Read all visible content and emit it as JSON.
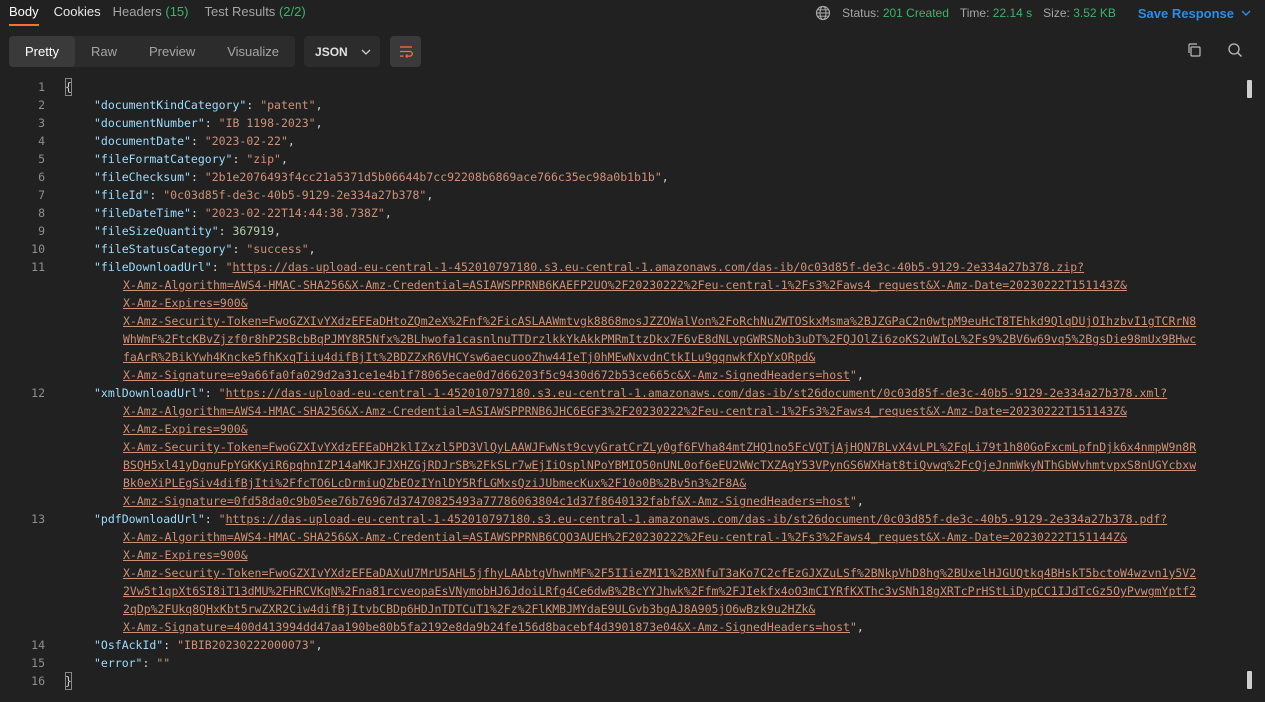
{
  "tabs": {
    "body": "Body",
    "cookies": "Cookies",
    "headers_label": "Headers",
    "headers_count": "(15)",
    "tests_label": "Test Results",
    "tests_count": "(2/2)"
  },
  "status": {
    "status_label": "Status:",
    "status_value": "201 Created",
    "time_label": "Time:",
    "time_value": "22.14 s",
    "size_label": "Size:",
    "size_value": "3.52 KB",
    "save_response": "Save Response"
  },
  "toolbar": {
    "pretty": "Pretty",
    "raw": "Raw",
    "preview": "Preview",
    "visualize": "Visualize",
    "format": "JSON"
  },
  "editor": {
    "line_numbers": [
      "1",
      "2",
      "3",
      "4",
      "5",
      "6",
      "7",
      "8",
      "9",
      "10",
      "11",
      "12",
      "13",
      "14",
      "15",
      "16"
    ],
    "open_brace": "{",
    "close_brace": "}",
    "entries": {
      "documentKindCategory": {
        "key": "\"documentKindCategory\"",
        "value": "\"patent\""
      },
      "documentNumber": {
        "key": "\"documentNumber\"",
        "value": "\"IB 1198-2023\""
      },
      "documentDate": {
        "key": "\"documentDate\"",
        "value": "\"2023-02-22\""
      },
      "fileFormatCategory": {
        "key": "\"fileFormatCategory\"",
        "value": "\"zip\""
      },
      "fileChecksum": {
        "key": "\"fileChecksum\"",
        "value": "\"2b1e2076493f4cc21a5371d5b06644b7cc92208b6869ace766c35ec98a0b1b1b\""
      },
      "fileId": {
        "key": "\"fileId\"",
        "value": "\"0c03d85f-de3c-40b5-9129-2e334a27b378\""
      },
      "fileDateTime": {
        "key": "\"fileDateTime\"",
        "value": "\"2023-02-22T14:44:38.738Z\""
      },
      "fileSizeQuantity": {
        "key": "\"fileSizeQuantity\"",
        "value": "367919"
      },
      "fileStatusCategory": {
        "key": "\"fileStatusCategory\"",
        "value": "\"success\""
      },
      "fileDownloadUrl": {
        "key": "\"fileDownloadUrl\"",
        "q": "\"",
        "lines": [
          "https://das-upload-eu-central-1-452010797180.s3.eu-central-1.amazonaws.com/das-ib/0c03d85f-de3c-40b5-9129-2e334a27b378.zip?",
          "X-Amz-Algorithm=AWS4-HMAC-SHA256&X-Amz-Credential=ASIAWSPPRNB6KAEFP2UO%2F20230222%2Feu-central-1%2Fs3%2Faws4_request&X-Amz-Date=20230222T151143Z&",
          "X-Amz-Expires=900&",
          "X-Amz-Security-Token=FwoGZXIvYXdzEFEaDHtoZQm2eX%2Fnf%2FicASLAAWmtvgk8868mosJZZOWalVon%2FoRchNuZWTOSkxMsma%2BJZGPaC2n0wtpM9euHcT8TEhkd9QlqDUjOIhzbvI1gTCRrN8",
          "WhWmF%2FtcKBvZjzf0r8hP2SBcbBqPJMY8R5Nfx%2BLhwofa1casnlnuTTDrzlkkYkAkkPMRmItzDkx7F6vE8dNLvpGWRSNob3uDT%2FQJOlZi6zoKS2uWIoL%2Fs9%2BV6w69vq5%2BgsDie98mUx9BHwc",
          "faArR%2BikYwh4Kncke5fhKxqTiiu4difBjIt%2BDZZxR6VHCYsw6aecuooZhw44IeTj0hMEwNxvdnCtkILu9gqnwkfXpYxORpd&",
          "X-Amz-Signature=e9a66fa0fa029d2a31ce1e4b1f78065ecae0d7d66203f5c9430d672b53ce665c&X-Amz-SignedHeaders=host"
        ]
      },
      "xmlDownloadUrl": {
        "key": "\"xmlDownloadUrl\"",
        "q": "\"",
        "lines": [
          "https://das-upload-eu-central-1-452010797180.s3.eu-central-1.amazonaws.com/das-ib/st26document/0c03d85f-de3c-40b5-9129-2e334a27b378.xml?",
          "X-Amz-Algorithm=AWS4-HMAC-SHA256&X-Amz-Credential=ASIAWSPPRNB6JHC6EGF3%2F20230222%2Feu-central-1%2Fs3%2Faws4_request&X-Amz-Date=20230222T151143Z&",
          "X-Amz-Expires=900&",
          "X-Amz-Security-Token=FwoGZXIvYXdzEFEaDH2klIZxzl5PD3VlQyLAAWJFwNst9cvyGratCrZLy0gf6FVha84mtZHQ1no5FcVQTjAjHQN7BLvX4vLPL%2FqLi79t1h80GoFxcmLpfnDjk6x4nmpW9n8R",
          "BSQH5xl41yDgnuFpYGKKyiR6pqhnIZP14aMKJFJXHZGjRDJrSB%2FkSLr7wEjIiOsplNPoYBMIO50nUNL0of6eEU2WWcTXZAgY53VPynGS6WXHat8tiQvwq%2FcQjeJnmWkyNThGbWvhmtvpxS8nUGYcbxw",
          "Bk0eXiPLEgSiv4difBjIti%2FfcTO6LcDrmiuQZbEOzIYnlDY5RfLGMxsQziJUbmecKux%2F10o0B%2Bv5n3%2F8A&",
          "X-Amz-Signature=0fd58da0c9b05ee76b76967d37470825493a77786063804c1d37f8640132fabf&X-Amz-SignedHeaders=host"
        ]
      },
      "pdfDownloadUrl": {
        "key": "\"pdfDownloadUrl\"",
        "q": "\"",
        "lines": [
          "https://das-upload-eu-central-1-452010797180.s3.eu-central-1.amazonaws.com/das-ib/st26document/0c03d85f-de3c-40b5-9129-2e334a27b378.pdf?",
          "X-Amz-Algorithm=AWS4-HMAC-SHA256&X-Amz-Credential=ASIAWSPPRNB6CQO3AUEH%2F20230222%2Feu-central-1%2Fs3%2Faws4_request&X-Amz-Date=20230222T151144Z&",
          "X-Amz-Expires=900&",
          "X-Amz-Security-Token=FwoGZXIvYXdzEFEaDAXuU7MrU5AHL5jfhyLAAbtgVhwnMF%2F5IIieZMI1%2BXNfuT3aKo7C2cfEzGJXZuLSf%2BNkpVhD8hg%2BUxelHJGUQtkq4BHskT5bctoW4wzvn1y5V2",
          "2Vw5t1qpXt6SI8iT13dMU%2FHRCVKqN%2Fna81rcveopaEsVNymobHJ6JdoiLRfg4Ce6dwB%2BcYYJhwk%2Ffm%2FJIekfx4oO3mCIYRfKXThc3vSNh18gXRTcPrHStLiDypCC1IJdTcGz5OyPvwgmYptf2",
          "2qDp%2FUkq8QHxKbt5rwZXR2Ciw4difBjItvbCBDp6HDJnTDTCuT1%2Fz%2FlKMBJMYdaE9ULGvb3bgAJ8A905jO6wBzk9u2HZk&",
          "X-Amz-Signature=400d413994dd47aa190be80b5fa2192e8da9b24fe156d8bacebf4d3901873e04&X-Amz-SignedHeaders=host"
        ]
      },
      "OsfAckId": {
        "key": "\"OsfAckId\"",
        "value": "\"IBIB20230222000073\""
      },
      "error": {
        "key": "\"error\"",
        "value": "\"\""
      }
    }
  }
}
